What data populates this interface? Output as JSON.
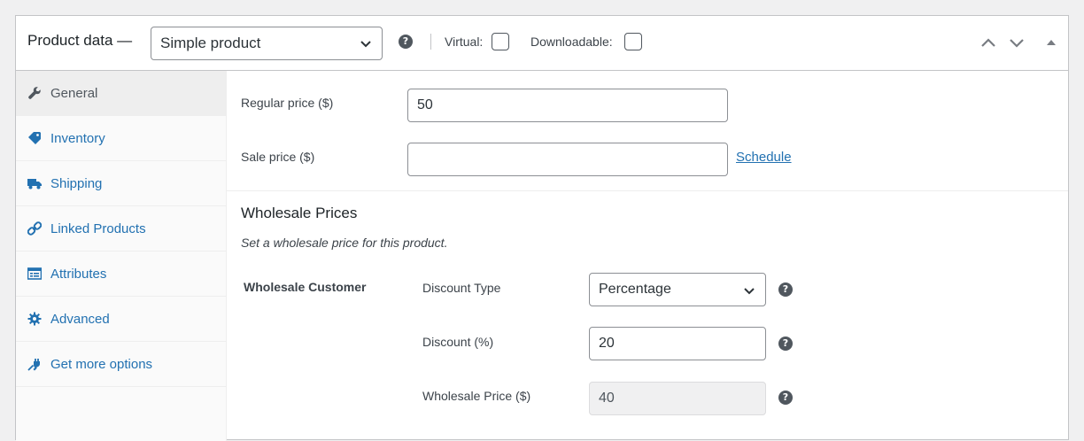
{
  "header": {
    "title": "Product data —",
    "product_type": {
      "selected": "Simple product",
      "options": [
        "Simple product"
      ]
    },
    "virtual_label": "Virtual:",
    "virtual_checked": false,
    "downloadable_label": "Downloadable:",
    "downloadable_checked": false
  },
  "tabs": [
    {
      "label": "General",
      "icon": "wrench-icon",
      "active": true
    },
    {
      "label": "Inventory",
      "icon": "tag-icon",
      "active": false
    },
    {
      "label": "Shipping",
      "icon": "truck-icon",
      "active": false
    },
    {
      "label": "Linked Products",
      "icon": "link-icon",
      "active": false
    },
    {
      "label": "Attributes",
      "icon": "list-icon",
      "active": false
    },
    {
      "label": "Advanced",
      "icon": "gear-icon",
      "active": false
    },
    {
      "label": "Get more options",
      "icon": "plugin-icon",
      "active": false
    }
  ],
  "general": {
    "regular_price_label": "Regular price ($)",
    "regular_price_value": "50",
    "sale_price_label": "Sale price ($)",
    "sale_price_value": "",
    "schedule_link": "Schedule"
  },
  "wholesale": {
    "title": "Wholesale Prices",
    "description": "Set a wholesale price for this product.",
    "role": "Wholesale Customer",
    "discount_type_label": "Discount Type",
    "discount_type_value": "Percentage",
    "discount_label": "Discount (%)",
    "discount_value": "20",
    "wholesale_price_label": "Wholesale Price ($)",
    "wholesale_price_value": "40"
  },
  "colors": {
    "link": "#2271b1",
    "border": "#c3c4c7",
    "active_tab_bg": "#eeeeee"
  }
}
